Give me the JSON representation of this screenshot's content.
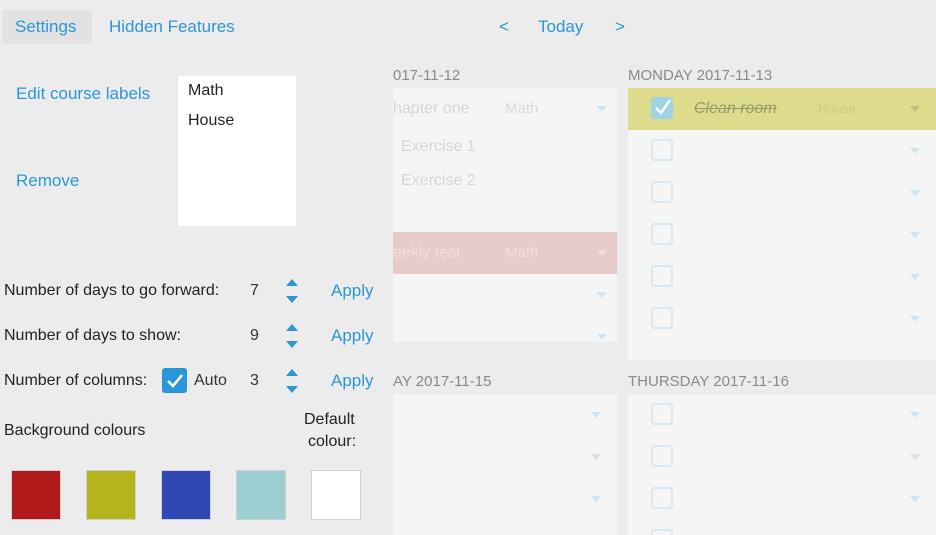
{
  "header": {
    "tabs": [
      {
        "label": "Settings",
        "active": true
      },
      {
        "label": "Hidden Features",
        "active": false
      }
    ],
    "prev": "<",
    "today": "Today",
    "next": ">"
  },
  "calendar": {
    "days": [
      {
        "header": "017-11-12",
        "tasks": [
          {
            "title": "hapter one",
            "course": "Math",
            "highlight": ""
          },
          {
            "title": "Exercise 1",
            "course": "",
            "highlight": ""
          },
          {
            "title": "Exercise 2",
            "course": "",
            "highlight": ""
          },
          {
            "title": "",
            "course": "",
            "highlight": ""
          },
          {
            "title": "eekly test",
            "course": "Math",
            "highlight": "#e8cccc"
          },
          {
            "title": "",
            "course": "",
            "highlight": ""
          },
          {
            "title": "",
            "course": "",
            "highlight": ""
          }
        ]
      },
      {
        "header": "MONDAY 2017-11-13",
        "tasks": [
          {
            "title": "Clean room",
            "course": "House",
            "done": true,
            "highlight": "#dcdc8c"
          },
          {
            "title": "",
            "course": "",
            "done": false
          },
          {
            "title": "",
            "course": "",
            "done": false
          },
          {
            "title": "",
            "course": "",
            "done": false
          },
          {
            "title": "",
            "course": "",
            "done": false
          },
          {
            "title": "",
            "course": "",
            "done": false
          }
        ]
      },
      {
        "header": "AY 2017-11-15",
        "tasks": [
          {
            "title": "",
            "course": ""
          },
          {
            "title": "",
            "course": ""
          },
          {
            "title": "",
            "course": ""
          }
        ]
      },
      {
        "header": "THURSDAY 2017-11-16",
        "tasks": [
          {
            "title": "",
            "course": "",
            "done": false
          },
          {
            "title": "",
            "course": "",
            "done": false
          },
          {
            "title": "",
            "course": "",
            "done": false
          },
          {
            "title": "",
            "course": "",
            "done": false
          }
        ]
      }
    ]
  },
  "settings": {
    "edit_labels": "Edit course labels",
    "remove": "Remove",
    "course_labels": [
      "Math",
      "House"
    ],
    "rows": [
      {
        "label": "Number of days to go forward:",
        "value": "7",
        "apply": "Apply"
      },
      {
        "label": "Number of days to show:",
        "value": "9",
        "apply": "Apply"
      },
      {
        "label": "Number of columns:",
        "value": "3",
        "apply": "Apply",
        "auto_label": "Auto",
        "auto_checked": true
      }
    ],
    "bg_label": "Background colours",
    "default_label_1": "Default",
    "default_label_2": "colour:",
    "swatches": [
      "#b01a1a",
      "#b4b41c",
      "#3148b4",
      "#9bcfd1",
      "#ffffff"
    ]
  },
  "colors": {
    "accent": "#2a96d8"
  }
}
